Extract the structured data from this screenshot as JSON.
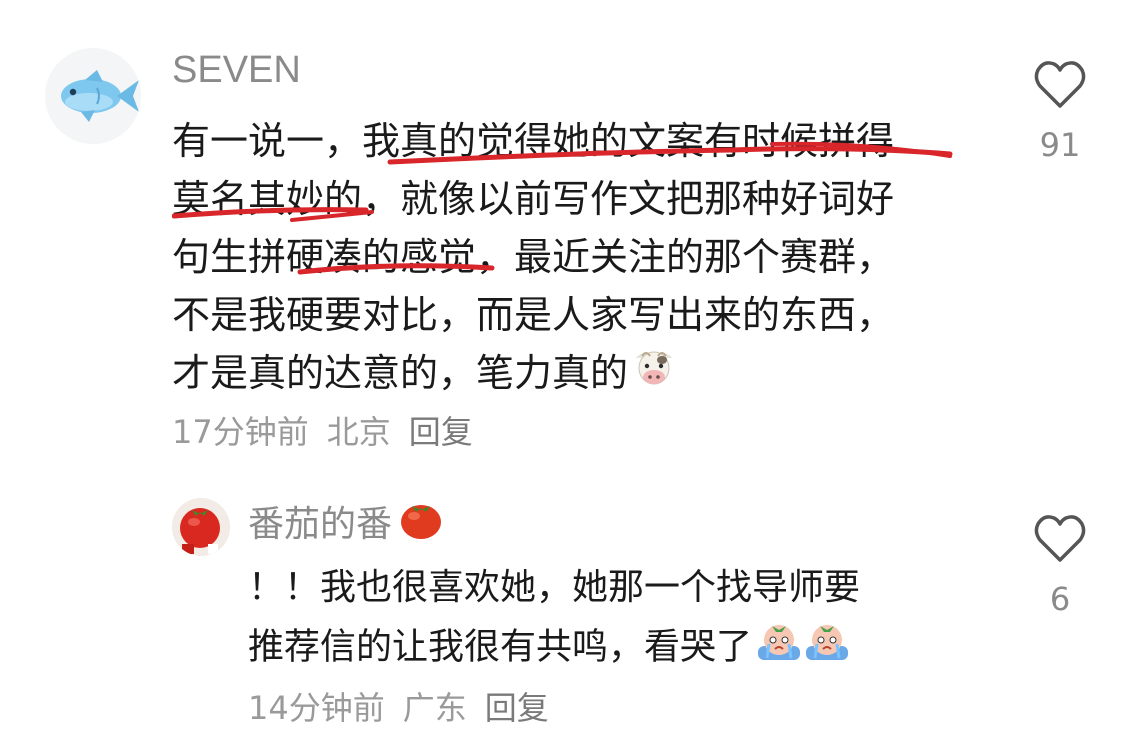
{
  "comments": [
    {
      "username": "SEVEN",
      "lines": [
        "有一说一，我真的觉得她的文案有时候拼得",
        "莫名其妙的，就像以前写作文把那种好词好",
        "句生拼硬凑的感觉，最近关注的那个赛群，",
        "不是我硬要对比，而是人家写出来的东西，",
        "才是真的达意的，笔力真的"
      ],
      "emoji": "cow-face",
      "time": "17分钟前",
      "location": "北京",
      "reply_label": "回复",
      "likes": "91",
      "avatar_icon": "fish-avatar",
      "highlight_color": "#d8262a"
    },
    {
      "username": "番茄的番",
      "username_emoji": "tomato",
      "lines": [
        "！！我也很喜欢她，她那一个找导师要",
        "推荐信的让我很有共鸣，看哭了"
      ],
      "emoji": "crying-face",
      "time": "14分钟前",
      "location": "广东",
      "reply_label": "回复",
      "likes": "6",
      "avatar_icon": "tomato-avatar"
    }
  ]
}
